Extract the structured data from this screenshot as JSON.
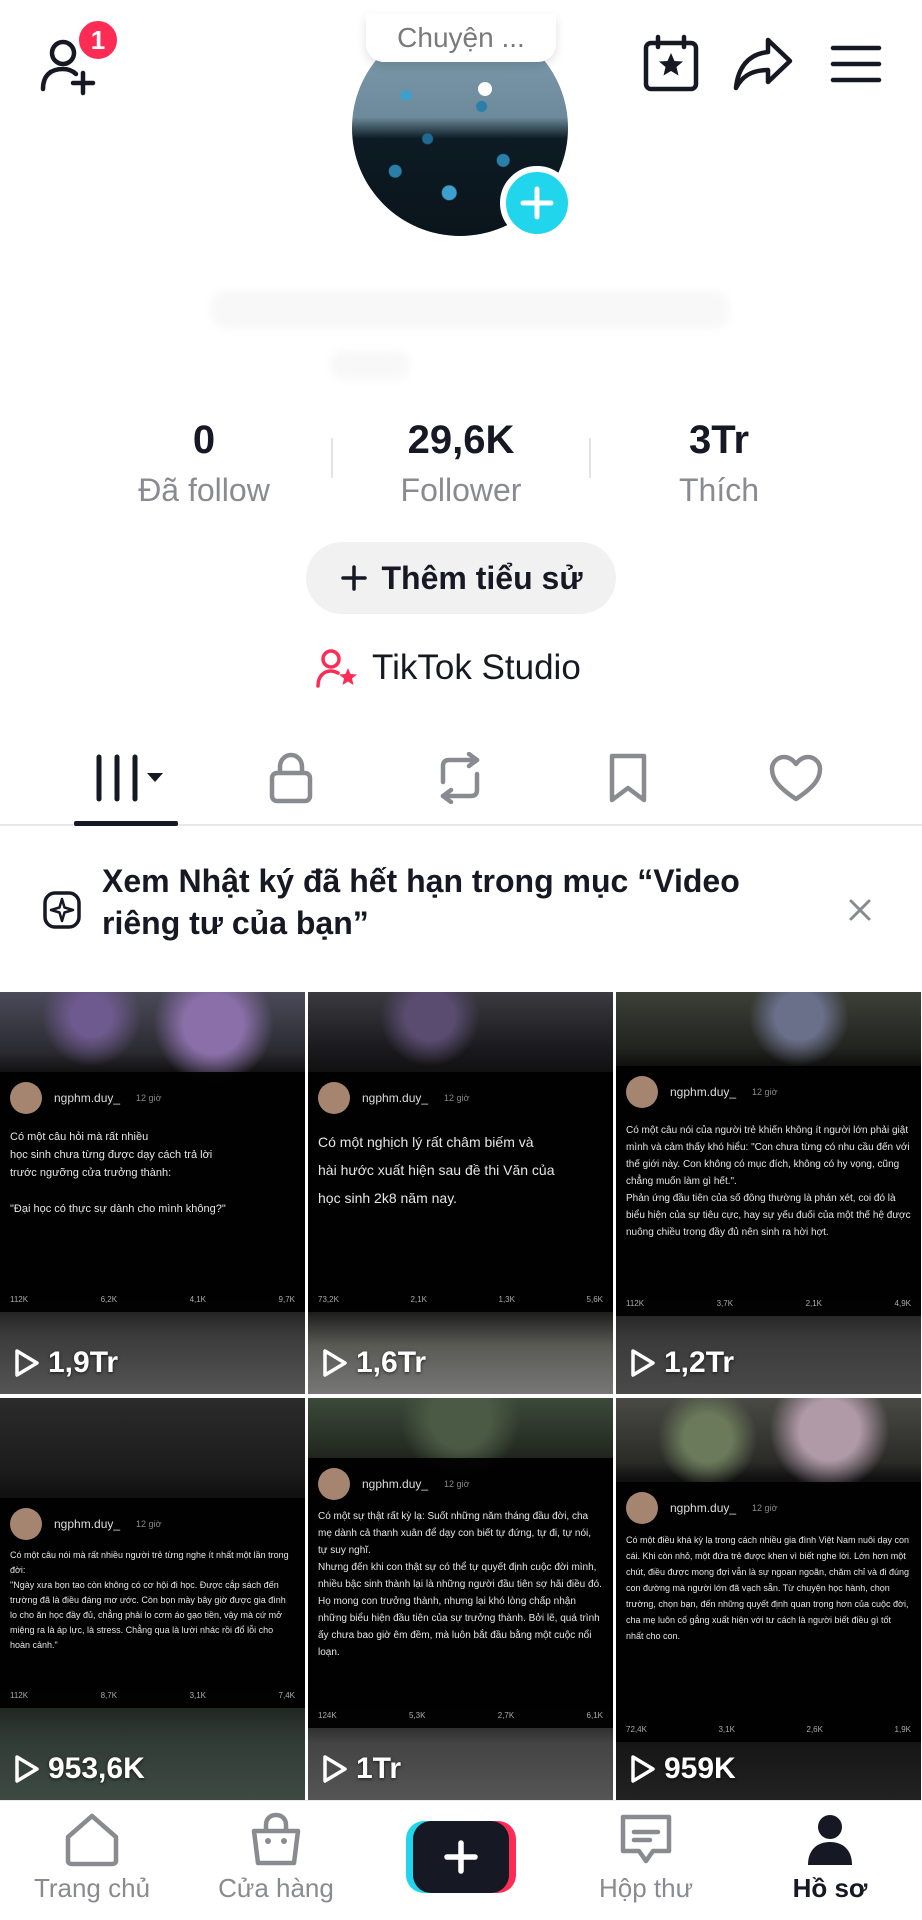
{
  "header": {
    "notification_count": "1",
    "note_text": "Chuyện ..."
  },
  "stats": {
    "following": {
      "value": "0",
      "label": "Đã follow"
    },
    "followers": {
      "value": "29,6K",
      "label": "Follower"
    },
    "likes": {
      "value": "3Tr",
      "label": "Thích"
    }
  },
  "bio_button_label": "Thêm tiểu sử",
  "studio_label": "TikTok Studio",
  "tabs": [
    "videos-grid",
    "private",
    "reposts",
    "saved",
    "liked"
  ],
  "banner": {
    "text": "Xem Nhật ký đã hết hạn trong mục “Video riêng tư của bạn”"
  },
  "videos": [
    {
      "views": "1,9Tr",
      "user": "ngphm.duy_",
      "time": "12 giờ",
      "text": "Có một câu hỏi mà rất nhiều\nhọc sinh chưa từng được dạy cách trả lời\ntrước ngưỡng cửa trưởng thành:\n\n\"Đại học có thực sự dành cho mình không?\"",
      "likes": "112K",
      "comments": "6,2K",
      "reposts": "4,1K",
      "shares": "9,7K"
    },
    {
      "views": "1,6Tr",
      "user": "ngphm.duy_",
      "time": "12 giờ",
      "text": "Có một nghịch lý rất châm biếm và\nhài hước xuất hiện sau đề thi Văn của\nhọc sinh 2k8 năm nay.",
      "likes": "73,2K",
      "comments": "2,1K",
      "reposts": "1,3K",
      "shares": "5,6K"
    },
    {
      "views": "1,2Tr",
      "user": "ngphm.duy_",
      "time": "12 giờ",
      "text": "Có một câu nói của người trẻ khiến không ít người lớn phải giật mình và cảm thấy khó hiểu: \"Con chưa từng có nhu cầu đến với thế giới này. Con không có mục đích, không có hy vọng, cũng chẳng muốn làm gì hết.\".\nPhản ứng đầu tiên của số đông thường là phán xét, coi đó là biểu hiện của sự tiêu cực, hay sự yếu đuối của một thế hệ được nuông chiều trong đầy đủ nên sinh ra hời hợt.",
      "likes": "112K",
      "comments": "3,7K",
      "reposts": "2,1K",
      "shares": "4,9K"
    },
    {
      "views": "953,6K",
      "user": "ngphm.duy_",
      "time": "12 giờ",
      "text": "Có một câu nói mà rất nhiều người trẻ từng nghe ít nhất một lần trong đời:\n\"Ngày xưa bọn tao còn không có cơ hội đi học. Được cắp sách đến trường đã là điều đáng mơ ước. Còn bọn mày bây giờ được gia đình lo cho ăn học đầy đủ, chẳng phải lo cơm áo gạo tiền, vậy mà cứ mở miệng ra là áp lực, là stress. Chẳng qua là lười nhác rồi đổ lỗi cho hoàn cảnh.\"",
      "likes": "112K",
      "comments": "8,7K",
      "reposts": "3,1K",
      "shares": "7,4K"
    },
    {
      "views": "1Tr",
      "user": "ngphm.duy_",
      "time": "12 giờ",
      "text": "Có một sự thật rất kỳ lạ: Suốt những năm tháng đầu đời, cha mẹ dành cả thanh xuân để dạy con biết tự đứng, tự đi, tự nói, tự suy nghĩ.\nNhưng đến khi con thật sự có thể tự quyết định cuộc đời mình, nhiều bậc sinh thành lại là những người đầu tiên sợ hãi điều đó.\nHọ mong con trưởng thành, nhưng lại khó lòng chấp nhận những biểu hiện đầu tiên của sự trưởng thành. Bởi lẽ, quá trình ấy chưa bao giờ êm đềm, mà luôn bắt đầu bằng một cuộc nổi loạn.",
      "likes": "124K",
      "comments": "5,3K",
      "reposts": "2,7K",
      "shares": "6,1K"
    },
    {
      "views": "959K",
      "user": "ngphm.duy_",
      "time": "12 giờ",
      "text": "Có một điều khá kỳ lạ trong cách nhiều gia đình Việt Nam nuôi dạy con cái. Khi còn nhỏ, một đứa trẻ được khen vì biết nghe lời. Lớn hơn một chút, điều được mong đợi vẫn là sự ngoan ngoãn, chăm chỉ và đi đúng con đường mà người lớn đã vạch sẵn. Từ chuyện học hành, chọn trường, chọn bạn, đến những quyết định quan trọng hơn của cuộc đời, cha mẹ luôn cố gắng xuất hiện với tư cách là người biết điều gì tốt nhất cho con.",
      "likes": "72,4K",
      "comments": "3,1K",
      "reposts": "2,6K",
      "shares": "1,9K"
    }
  ],
  "bottom_nav": {
    "home": "Trang chủ",
    "shop": "Cửa hàng",
    "inbox": "Hộp thư",
    "profile": "Hồ sơ"
  },
  "colors": {
    "accent": "#fe2c55",
    "cyan": "#20d5ec",
    "text": "#161823",
    "muted": "#8a8b91"
  }
}
